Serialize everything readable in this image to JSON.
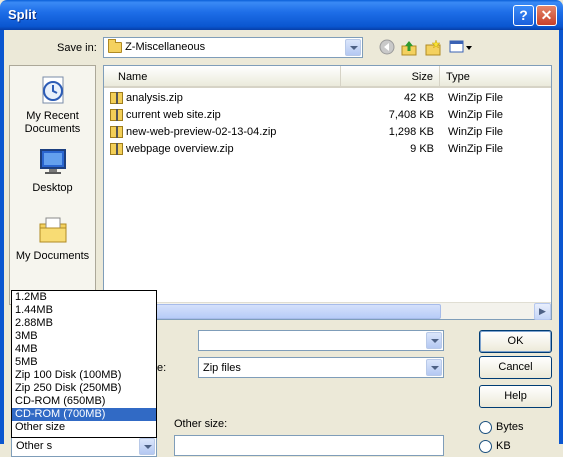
{
  "window": {
    "title": "Split",
    "help_glyph": "?",
    "close_glyph": "✕"
  },
  "save_in": {
    "label": "Save in:",
    "value": "Z-Miscellaneous"
  },
  "toolbar": {
    "back_icon": "back-icon",
    "up_icon": "up-folder-icon",
    "new_folder_icon": "new-folder-icon",
    "views_icon": "views-menu-icon"
  },
  "places": [
    {
      "label": "My Recent Documents",
      "icon": "recent-documents-icon"
    },
    {
      "label": "Desktop",
      "icon": "desktop-icon"
    },
    {
      "label": "My Documents",
      "icon": "my-documents-icon"
    }
  ],
  "file_list": {
    "headers": {
      "name": "Name",
      "size": "Size",
      "type": "Type"
    },
    "files": [
      {
        "name": "analysis.zip",
        "size": "42 KB",
        "type": "WinZip File"
      },
      {
        "name": "current web site.zip",
        "size": "7,408 KB",
        "type": "WinZip File"
      },
      {
        "name": "new-web-preview-02-13-04.zip",
        "size": "1,298 KB",
        "type": "WinZip File"
      },
      {
        "name": "webpage overview.zip",
        "size": "9 KB",
        "type": "WinZip File"
      }
    ]
  },
  "file_name": {
    "value": ""
  },
  "save_as_type": {
    "label_partial": "e:",
    "value": "Zip files"
  },
  "buttons": {
    "ok": "OK",
    "cancel": "Cancel",
    "help": "Help"
  },
  "split_size": {
    "options": [
      "1.2MB",
      "1.44MB",
      "2.88MB",
      "3MB",
      "4MB",
      "5MB",
      "Zip 100 Disk (100MB)",
      "Zip 250 Disk (250MB)",
      "CD-ROM (650MB)",
      "CD-ROM (700MB)",
      "Other size"
    ],
    "selected_index": 9,
    "collapsed_value_partial": "Other s",
    "other_size_label": "Other size:",
    "other_size_value": ""
  },
  "units": {
    "bytes_label": "Bytes",
    "kb_partial": "KB"
  }
}
